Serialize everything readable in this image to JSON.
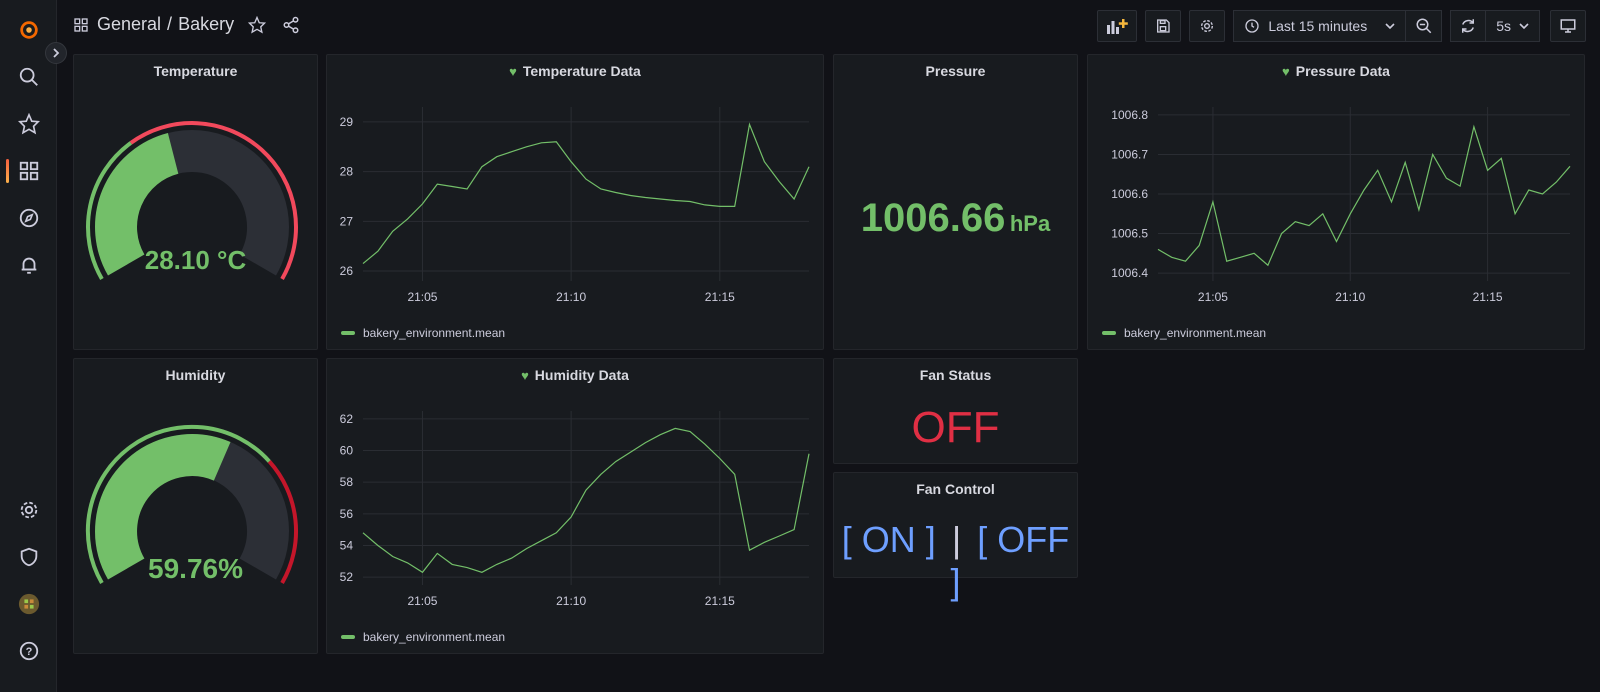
{
  "breadcrumb": {
    "folder": "General",
    "separator": "/",
    "dashboard": "Bakery"
  },
  "toolbar": {
    "time_range": "Last 15 minutes",
    "refresh_interval": "5s"
  },
  "colors": {
    "green": "#73bf69",
    "red": "#f2495c",
    "blue": "#6e9fff",
    "background": "#111217",
    "panel": "#181b1f"
  },
  "panels": {
    "temperature": {
      "title": "Temperature",
      "value": "28.10 °C",
      "fraction": 0.44,
      "threshold_fraction": 0.35
    },
    "temperature_data": {
      "title": "Temperature Data",
      "legend": "bakery_environment.mean"
    },
    "pressure": {
      "title": "Pressure",
      "value": "1006.66",
      "unit": "hPa"
    },
    "pressure_data": {
      "title": "Pressure Data",
      "legend": "bakery_environment.mean"
    },
    "humidity": {
      "title": "Humidity",
      "value": "59.76%",
      "fraction": 0.5976,
      "threshold_fraction": 0.7
    },
    "humidity_data": {
      "title": "Humidity Data",
      "legend": "bakery_environment.mean"
    },
    "fan_status": {
      "title": "Fan Status",
      "value": "OFF"
    },
    "fan_control": {
      "title": "Fan Control",
      "on_label": "[ ON ]",
      "separator": "|",
      "off_label": "[ OFF ]"
    }
  },
  "chart_data": [
    {
      "type": "line",
      "title": "Temperature Data",
      "x": [
        "21:03",
        "21:03.5",
        "21:04",
        "21:04.5",
        "21:05",
        "21:05.5",
        "21:06",
        "21:06.5",
        "21:07",
        "21:07.5",
        "21:08",
        "21:08.5",
        "21:09",
        "21:09.5",
        "21:10",
        "21:10.5",
        "21:11",
        "21:11.5",
        "21:12",
        "21:12.5",
        "21:13",
        "21:13.5",
        "21:14",
        "21:14.5",
        "21:15",
        "21:15.5",
        "21:16",
        "21:16.5",
        "21:17",
        "21:17.5",
        "21:18"
      ],
      "xticks": [
        "21:05",
        "21:10",
        "21:15"
      ],
      "yticks": [
        "26",
        "27",
        "28",
        "29"
      ],
      "ylim": [
        25.8,
        29.3
      ],
      "series": [
        {
          "name": "bakery_environment.mean",
          "values": [
            26.15,
            26.4,
            26.8,
            27.05,
            27.35,
            27.75,
            27.7,
            27.65,
            28.1,
            28.3,
            28.4,
            28.5,
            28.58,
            28.6,
            28.2,
            27.85,
            27.65,
            27.58,
            27.52,
            27.48,
            27.45,
            27.42,
            27.4,
            27.33,
            27.3,
            27.3,
            28.95,
            28.2,
            27.8,
            27.45,
            28.1
          ]
        }
      ],
      "legend": "bottom-left"
    },
    {
      "type": "line",
      "title": "Pressure Data",
      "x": [
        "21:03",
        "21:03.5",
        "21:04",
        "21:04.5",
        "21:05",
        "21:05.5",
        "21:06",
        "21:06.5",
        "21:07",
        "21:07.5",
        "21:08",
        "21:08.5",
        "21:09",
        "21:09.5",
        "21:10",
        "21:10.5",
        "21:11",
        "21:11.5",
        "21:12",
        "21:12.5",
        "21:13",
        "21:13.5",
        "21:14",
        "21:14.5",
        "21:15",
        "21:15.5",
        "21:16",
        "21:16.5",
        "21:17",
        "21:17.5",
        "21:18"
      ],
      "xticks": [
        "21:05",
        "21:10",
        "21:15"
      ],
      "yticks": [
        "1006.4",
        "1006.5",
        "1006.6",
        "1006.7",
        "1006.8"
      ],
      "ylim": [
        1006.38,
        1006.82
      ],
      "series": [
        {
          "name": "bakery_environment.mean",
          "values": [
            1006.46,
            1006.44,
            1006.43,
            1006.47,
            1006.58,
            1006.43,
            1006.44,
            1006.45,
            1006.42,
            1006.5,
            1006.53,
            1006.52,
            1006.55,
            1006.48,
            1006.55,
            1006.61,
            1006.66,
            1006.58,
            1006.68,
            1006.56,
            1006.7,
            1006.64,
            1006.62,
            1006.77,
            1006.66,
            1006.69,
            1006.55,
            1006.61,
            1006.6,
            1006.63,
            1006.67
          ]
        }
      ],
      "legend": "bottom-left"
    },
    {
      "type": "line",
      "title": "Humidity Data",
      "x": [
        "21:03",
        "21:03.5",
        "21:04",
        "21:04.5",
        "21:05",
        "21:05.5",
        "21:06",
        "21:06.5",
        "21:07",
        "21:07.5",
        "21:08",
        "21:08.5",
        "21:09",
        "21:09.5",
        "21:10",
        "21:10.5",
        "21:11",
        "21:11.5",
        "21:12",
        "21:12.5",
        "21:13",
        "21:13.5",
        "21:14",
        "21:14.5",
        "21:15",
        "21:15.5",
        "21:16",
        "21:16.5",
        "21:17",
        "21:17.5",
        "21:18"
      ],
      "xticks": [
        "21:05",
        "21:10",
        "21:15"
      ],
      "yticks": [
        "52",
        "54",
        "56",
        "58",
        "60",
        "62"
      ],
      "ylim": [
        51.5,
        62.5
      ],
      "series": [
        {
          "name": "bakery_environment.mean",
          "values": [
            54.8,
            54.0,
            53.3,
            52.9,
            52.3,
            53.5,
            52.8,
            52.6,
            52.3,
            52.8,
            53.2,
            53.8,
            54.3,
            54.8,
            55.8,
            57.5,
            58.5,
            59.3,
            59.9,
            60.5,
            61.0,
            61.4,
            61.2,
            60.4,
            59.5,
            58.5,
            53.7,
            54.2,
            54.6,
            55.0,
            59.8
          ]
        }
      ],
      "legend": "bottom-left"
    }
  ]
}
